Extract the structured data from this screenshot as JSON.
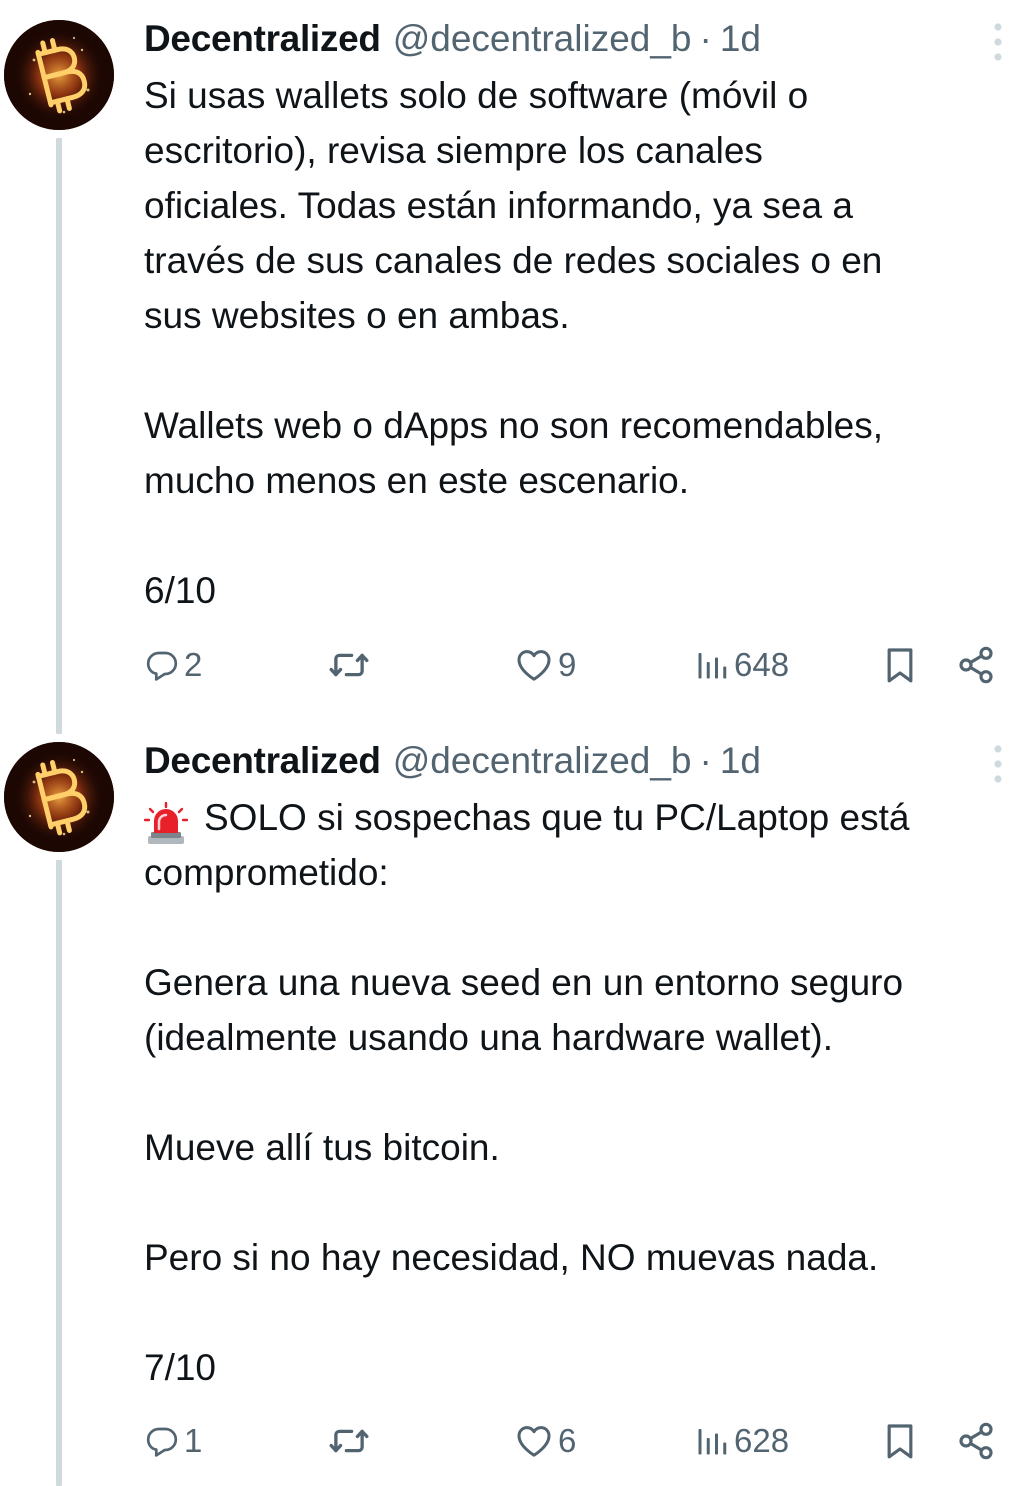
{
  "tweets": [
    {
      "author": {
        "display_name": "Decentralized",
        "handle": "@decentralized_b",
        "separator": "·",
        "time": "1d",
        "avatar_icon": "bitcoin-fire-avatar"
      },
      "emoji": "",
      "text": "Si usas wallets solo de software (móvil o\nescritorio), revisa siempre los canales\noficiales. Todas están informando, ya sea a\ntravés de sus canales de redes sociales o en\nsus websites o en ambas.\n\nWallets web o dApps no son recomendables,\nmucho menos en este escenario.\n\n6/10",
      "stats": {
        "replies": "2",
        "reposts": "",
        "likes": "9",
        "views": "648"
      }
    },
    {
      "author": {
        "display_name": "Decentralized",
        "handle": "@decentralized_b",
        "separator": "·",
        "time": "1d",
        "avatar_icon": "bitcoin-fire-avatar"
      },
      "emoji": "rotating-light-icon",
      "text": "SOLO si sospechas que tu PC/Laptop está\ncomprometido:\n\nGenera una nueva seed en un entorno seguro\n(idealmente usando una hardware wallet).\n\nMueve allí tus bitcoin.\n\nPero si no hay necesidad, NO muevas nada.\n\n7/10",
      "stats": {
        "replies": "1",
        "reposts": "",
        "likes": "6",
        "views": "628"
      }
    }
  ],
  "icons": {
    "reply": "reply-icon",
    "repost": "repost-icon",
    "like": "heart-icon",
    "views": "views-icon",
    "bookmark": "bookmark-icon",
    "share": "share-icon",
    "more": "more-vertical-icon"
  },
  "colors": {
    "text": "#0f1419",
    "secondary": "#536471",
    "thread_line": "#cfd9de",
    "alert_red": "#e8202a"
  }
}
